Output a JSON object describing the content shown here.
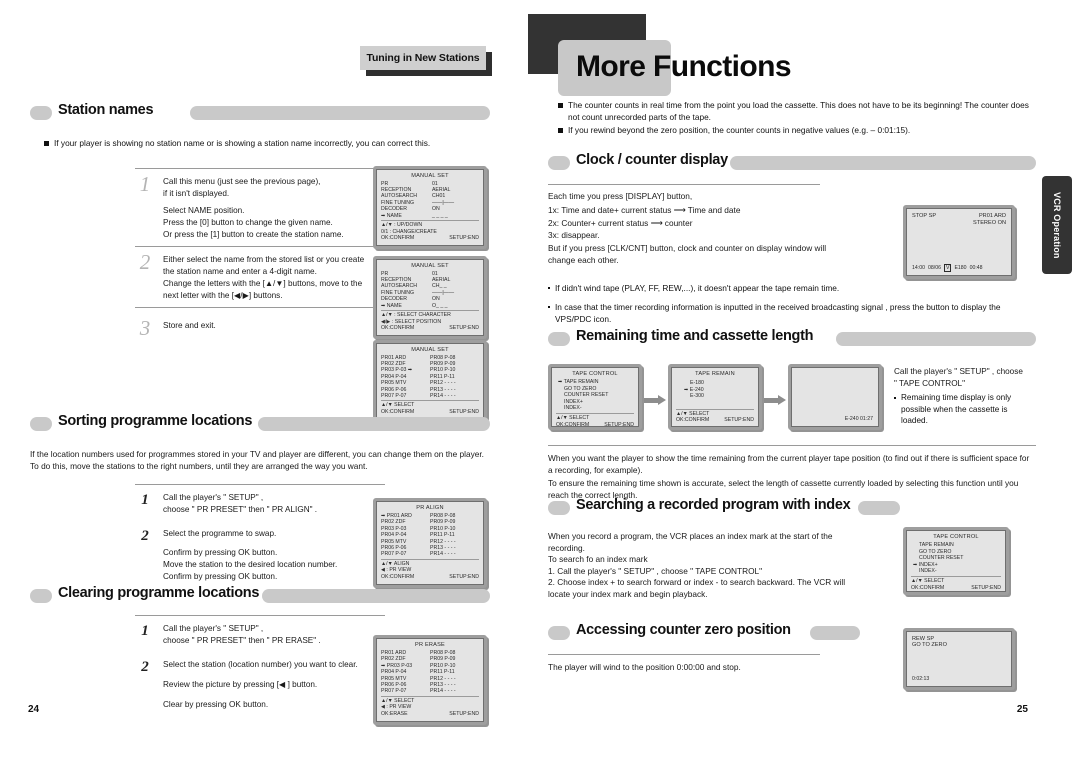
{
  "left_page": {
    "chapter_tab": "Tuning in New Stations",
    "page_number": "24",
    "sections": [
      {
        "id": "station-names",
        "title": "Station names",
        "intro_bullets": [
          "If your player is showing no station name or is showing a station name incorrectly, you can correct this."
        ],
        "steps": [
          {
            "num": "1",
            "lines": [
              "Call this menu (just see the previous page),",
              "if it isn't displayed.",
              "",
              "Select NAME position.",
              "Press the [0] button to change the given name.",
              "Or press the [1] button to create the station name."
            ]
          },
          {
            "num": "2",
            "lines": [
              "Either select the name from the stored list or you create",
              "the station name and enter a 4-digit name.",
              "Change the letters with the [▲/▼] buttons, move to the",
              "next letter with the [◀/▶] buttons."
            ]
          },
          {
            "num": "3",
            "lines": [
              "Store and exit."
            ]
          }
        ],
        "osd": [
          {
            "id": "manual-set-1",
            "title": "MANUAL SET",
            "rows": [
              {
                "k": "PR",
                "v": "01"
              },
              {
                "k": "RECEPTION",
                "v": "AERIAL"
              },
              {
                "k": "AUTOSEARCH",
                "v": "CH01"
              },
              {
                "k": "FINE TUNING",
                "v": "——|——"
              },
              {
                "k": "DECODER",
                "v": "ON"
              },
              {
                "k": "➡ NAME",
                "v": "_ _ _ _"
              }
            ],
            "hints": [
              "▲/▼ : UP/DOWN",
              "0/1 : CHANGE/CREATE"
            ],
            "foot_left": "OK:CONFIRM",
            "foot_right": "SETUP:END"
          },
          {
            "id": "manual-set-2",
            "title": "MANUAL SET",
            "rows": [
              {
                "k": "PR",
                "v": "01"
              },
              {
                "k": "RECEPTION",
                "v": "AERIAL"
              },
              {
                "k": "AUTOSEARCH",
                "v": "CH_ _"
              },
              {
                "k": "FINE TUNING",
                "v": "——|——"
              },
              {
                "k": "DECODER",
                "v": "ON"
              },
              {
                "k": "➡ NAME",
                "v": "O_ _ _"
              }
            ],
            "hints": [
              "▲/▼ : SELECT CHARACTER",
              "◀/▶ : SELECT POSITION"
            ],
            "foot_left": "OK:CONFIRM",
            "foot_right": "SETUP:END"
          },
          {
            "id": "manual-set-3",
            "title": "MANUAL SET",
            "list_left": [
              "PR01 ARD",
              "PR02 ZDF",
              "PR03 P-03 ➡",
              "PR04 P-04",
              "PR05 MTV",
              "PR06 P-06",
              "PR07 P-07"
            ],
            "list_right": [
              "PR08 P-08",
              "PR09 P-09",
              "PR10 P-10",
              "PR11 P-11",
              "PR12 - - - -",
              "PR13 - - - -",
              "PR14 - - - -"
            ],
            "hints": [
              "▲/▼ SELECT"
            ],
            "foot_left": "OK:CONFIRM",
            "foot_right": "SETUP:END"
          }
        ]
      },
      {
        "id": "sorting-programme-locations",
        "title": "Sorting programme locations",
        "paragraphs": [
          "If the location numbers used for programmes stored in your TV and player are different, you can change them on the player. To do this, move the stations to the right numbers, until they are arranged the way you want."
        ],
        "steps": [
          {
            "num": "1",
            "lines": [
              "Call the player's \" SETUP\" ,",
              "choose \" PR PRESET\"  then \" PR ALIGN\" ."
            ]
          },
          {
            "num": "2",
            "lines": [
              "Select the programme to swap.",
              "",
              "Confirm by pressing OK button.",
              "Move the station to the desired location number.",
              "Confirm by pressing OK button."
            ]
          }
        ],
        "osd": [
          {
            "id": "pr-align",
            "title": "PR ALIGN",
            "list_left": [
              "➡ PR01 ARD",
              "PR02 ZDF",
              "PR03 P-03",
              "PR04 P-04",
              "PR05 MTV",
              "PR06 P-06",
              "PR07 P-07"
            ],
            "list_right": [
              "PR08 P-08",
              "PR09 P-09",
              "PR10 P-10",
              "PR11 P-11",
              "PR12 - - - -",
              "PR13 - - - -",
              "PR14 - - - -"
            ],
            "hints": [
              "▲/▼ ALIGN",
              "◀ : PR VIEW"
            ],
            "foot_left": "OK:CONFIRM",
            "foot_right": "SETUP:END"
          }
        ]
      },
      {
        "id": "clearing-programme-locations",
        "title": "Clearing programme locations",
        "steps": [
          {
            "num": "1",
            "lines": [
              "Call the player's \" SETUP\" ,",
              "choose \" PR PRESET\"  then \" PR ERASE\" ."
            ]
          },
          {
            "num": "2",
            "lines": [
              "Select the station (location number) you want to clear.",
              "",
              "Review the picture by pressing [◀ ] button.",
              "",
              "Clear by pressing OK button."
            ]
          }
        ],
        "osd": [
          {
            "id": "pr-erase",
            "title": "PR ERASE",
            "list_left": [
              "PR01 ARD",
              "PR02 ZDF",
              "➡ PR03 P-03",
              "PR04 P-04",
              "PR05 MTV",
              "PR06 P-06",
              "PR07 P-07"
            ],
            "list_right": [
              "PR08 P-08",
              "PR09 P-09",
              "PR10 P-10",
              "PR11 P-11",
              "PR12 - - - -",
              "PR13 - - - -",
              "PR14 - - - -"
            ],
            "hints": [
              "▲/▼ SELECT",
              "◀ : PR VIEW"
            ],
            "foot_left": "OK:ERASE",
            "foot_right": "SETUP:END"
          }
        ]
      }
    ]
  },
  "right_page": {
    "title": "More Functions",
    "side_tab": "VCR Operation",
    "page_number": "25",
    "top_bullets": [
      "The counter counts in real time from the point you load the cassette. This does not have to be its beginning! The counter does not count unrecorded parts of the tape.",
      "If you rewind beyond the zero position, the counter counts in negative values  (e.g. – 0:01:15)."
    ],
    "sections": [
      {
        "id": "clock-counter-display",
        "title": "Clock / counter display",
        "lines": [
          "Each time you press [DISPLAY] button,",
          "1x: Time and date+ current status   ⟶  Time and date",
          "2x: Counter+ current status  ⟶  counter",
          "3x: disappear.",
          "But if you press [CLK/CNT] button, clock and counter on display window will change each other."
        ],
        "notes": [
          "If didn't wind tape (PLAY, FF, REW,...), it doesn't appear the tape remain time.",
          "In case that the timer recording information is inputted in the received broadcasting signal , press the button to display the VPS/PDC icon."
        ],
        "osd": {
          "id": "status-display",
          "top_left": "STOP  SP",
          "top_mid": "PR01   ARD",
          "second_right": "STEREO  ON",
          "bottom": "14:00 08/06   V   E180  00:48",
          "bottom_time": "14:00",
          "bottom_date": "08/06",
          "bottom_vps": "V",
          "bottom_tape": "E180",
          "bottom_counter": "00:48"
        }
      },
      {
        "id": "remaining-time-cassette-length",
        "title": "Remaining time and cassette length",
        "side_note_lines": [
          "Call the player's \" SETUP\" , choose",
          "\" TAPE CONTROL\""
        ],
        "side_note_bullet": "Remaining time display is only possible when the cassette is loaded.",
        "paragraphs": [
          "When you want the player to show the time remaining from the current player tape position (to find out if there is sufficient space for a recording, for example).",
          "To ensure the remaining time shown is accurate, select the length of cassette currently loaded by selecting this function until you reach the correct length."
        ],
        "osd": [
          {
            "id": "tape-control-remain",
            "title": "TAPE CONTROL",
            "items": [
              "➡ TAPE REMAIN",
              "GO TO ZERO",
              "COUNTER RESET",
              "INDEX+",
              "INDEX-"
            ],
            "hints": [
              "▲/▼ SELECT"
            ],
            "foot_left": "OK:CONFIRM",
            "foot_right": "SETUP:END"
          },
          {
            "id": "tape-remain-select",
            "title": "TAPE REMAIN",
            "items": [
              "E-180",
              "➡ E-240",
              "E-300"
            ],
            "hints": [
              "▲/▼ SELECT"
            ],
            "foot_left": "OK:CONFIRM",
            "foot_right": "SETUP:END"
          },
          {
            "id": "tape-remain-result",
            "title": "",
            "items": [],
            "result": "E-240  01:27"
          }
        ]
      },
      {
        "id": "searching-recorded-program-with-index",
        "title": "Searching a recorded program with index",
        "lines": [
          "When you record a program, the VCR places an index mark at the start of the recording.",
          "To search fo an index mark",
          "1. Call the player's \" SETUP\" , choose \" TAPE CONTROL\"",
          "2. Choose index + to search forward or index - to search backward. The VCR will locate your index mark and begin playback."
        ],
        "osd": {
          "id": "tape-control-index",
          "title": "TAPE CONTROL",
          "items": [
            "TAPE REMAIN",
            "GO TO ZERO",
            "COUNTER RESET",
            "➡ INDEX+",
            "INDEX-"
          ],
          "hints": [
            "▲/▼ SELECT"
          ],
          "foot_left": "OK:CONFIRM",
          "foot_right": "SETUP:END"
        }
      },
      {
        "id": "accessing-counter-zero-position",
        "title": "Accessing counter zero position",
        "lines": [
          "The player will wind to the position 0:00:00 and stop."
        ],
        "osd": {
          "id": "go-to-zero-display",
          "line1": "REW    SP",
          "line2": "GO TO ZERO",
          "counter": "0:02:13"
        }
      }
    ]
  }
}
